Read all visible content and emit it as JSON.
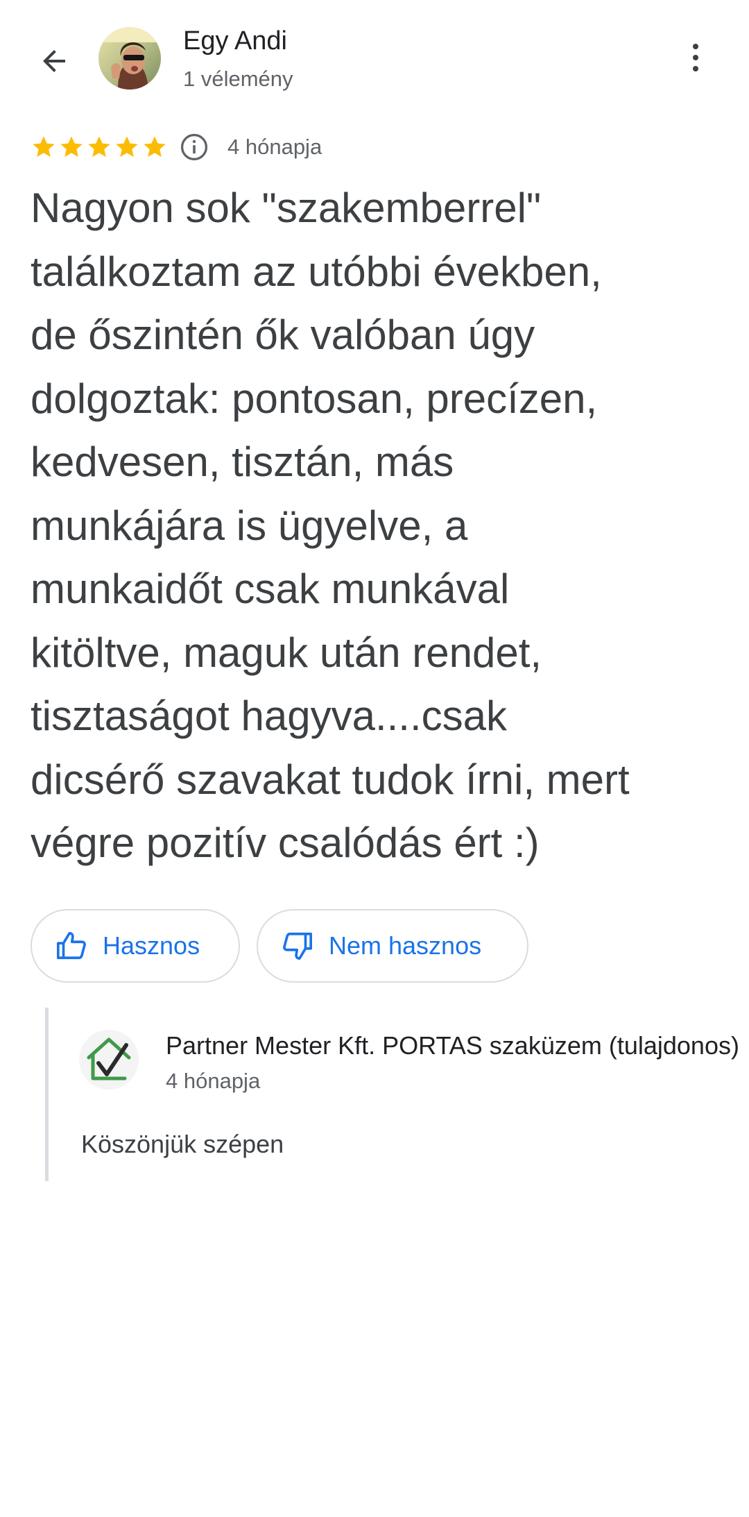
{
  "reviewer": {
    "name": "Egy Andi",
    "subtitle": "1 vélemény"
  },
  "rating": {
    "stars": 5,
    "date": "4 hónapja",
    "star_color": "#fbbc04"
  },
  "review": {
    "text": "Nagyon sok \"szakemberrel\"\ntalálkoztam az utóbbi években,\nde őszintén ők valóban úgy\ndolgoztak: pontosan, precízen,\nkedvesen, tisztán, más\nmunkájára is ügyelve, a\nmunkaidőt csak munkával\nkitöltve, maguk után rendet,\ntisztaságot hagyva....csak\ndicsérő szavakat tudok írni, mert\nvégre pozitív csalódás ért :)"
  },
  "feedback": {
    "helpful_label": "Hasznos",
    "not_helpful_label": "Nem hasznos",
    "accent_color": "#1a73e8"
  },
  "owner_reply": {
    "name": "Partner Mester Kft. PORTAS szaküzem (tulajdonos)",
    "date": "4 hónapja",
    "text": "Köszönjük szépen"
  },
  "icons": {
    "back": "arrow-left-icon",
    "more": "more-vert-icon",
    "info": "info-icon",
    "helpful": "thumb-up-icon",
    "not_helpful": "thumb-down-icon",
    "owner_logo": "house-check-logo"
  }
}
